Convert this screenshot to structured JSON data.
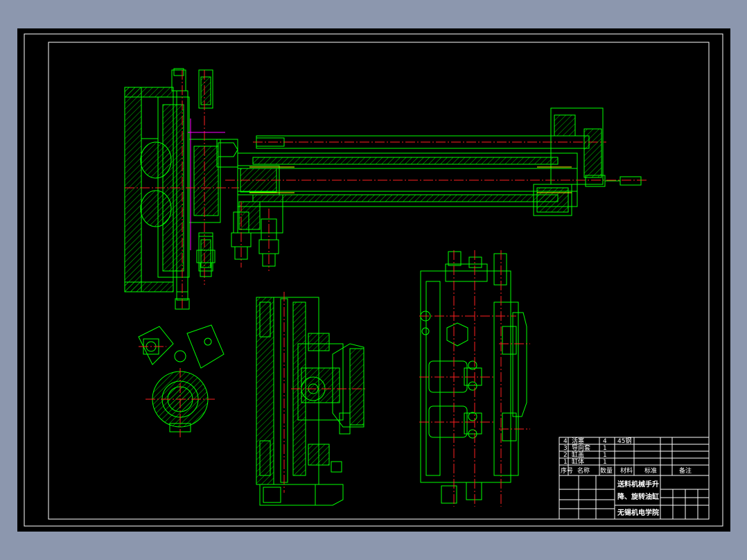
{
  "drawing": {
    "title_block": {
      "title_line1": "送料机械手升",
      "title_line2": "降、旋转油缸",
      "school": "无锡机电学院"
    },
    "parts_list": {
      "rows": [
        {
          "no": "4",
          "name": "活塞",
          "qty": "4",
          "material": "45钢"
        },
        {
          "no": "3",
          "name": "导向套",
          "qty": "1",
          "material": ""
        },
        {
          "no": "2",
          "name": "缸盖",
          "qty": "1",
          "material": ""
        },
        {
          "no": "1",
          "name": "缸体",
          "qty": "1",
          "material": ""
        }
      ],
      "header": {
        "no": "序号",
        "name": "名称",
        "qty": "数量",
        "material": "材料",
        "standard": "标准",
        "remark": "备注"
      }
    }
  },
  "colors": {
    "background_outer": "#8c97ae",
    "canvas": "#000000",
    "lines_main": "#00ff00",
    "lines_frame": "#ffffff",
    "centerlines": "#ff2020",
    "highlight": "#ff00ff",
    "dimension": "#ffff00"
  }
}
